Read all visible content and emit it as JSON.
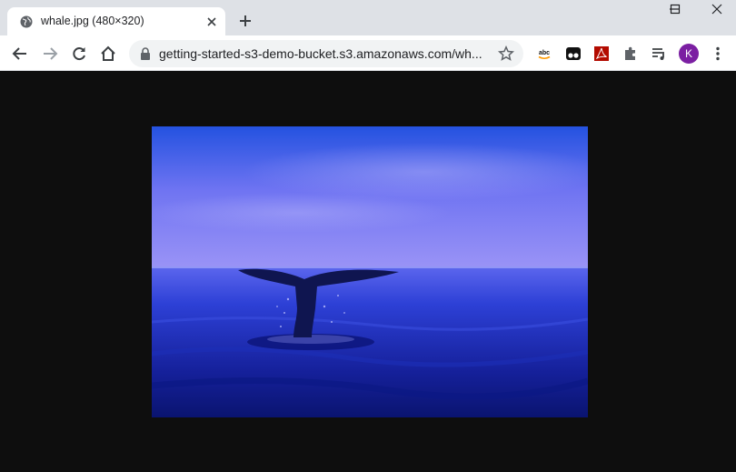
{
  "tab": {
    "title": "whale.jpg (480×320)"
  },
  "toolbar": {
    "url": "getting-started-s3-demo-bucket.s3.amazonaws.com/wh...",
    "avatar_letter": "K"
  },
  "icons": {
    "favicon": "globe-icon",
    "tab_close": "close-icon",
    "new_tab": "plus-icon",
    "minimize": "minimize-icon",
    "maximize": "maximize-icon",
    "close_window": "close-window-icon",
    "back": "back-arrow-icon",
    "forward": "forward-arrow-icon",
    "reload": "reload-icon",
    "home": "home-icon",
    "lock": "lock-icon",
    "bookmark": "star-icon",
    "extensions": [
      "amazon-extension-icon",
      "tampermonkey-extension-icon",
      "pdf-extension-icon",
      "puzzle-icon",
      "media-queue-icon"
    ],
    "menu": "kebab-menu-icon"
  },
  "colors": {
    "page_background": "#0e0e0e",
    "tabstrip": "#dee1e6",
    "avatar": "#7b1fa2"
  }
}
